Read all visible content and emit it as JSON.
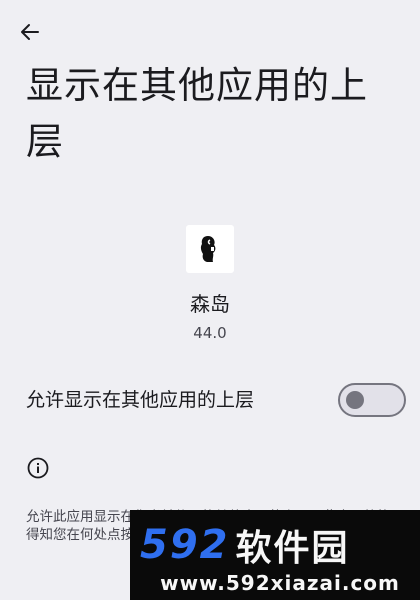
{
  "header": {
    "back_icon": "arrow-back-icon",
    "title": "显示在其他应用的上层"
  },
  "app": {
    "icon": "app-icon",
    "name": "森岛",
    "version": "44.0"
  },
  "permission": {
    "label": "允许显示在其他应用的上层",
    "enabled": false
  },
  "info": {
    "icon": "info-icon",
    "description": "允许此应用显示在您当前使用的其他应用的上层。此应用将能得知您在何处点按或更改屏幕上显示的内容。"
  },
  "watermark": {
    "logo_number": "592",
    "logo_name": "软件园",
    "url": "www.592xiazai.com"
  },
  "colors": {
    "background": "#efeff3",
    "text_primary": "#1b1b1f",
    "text_secondary": "#46464f",
    "switch_outline": "#75757f",
    "watermark_blue": "#2f6ff0"
  }
}
